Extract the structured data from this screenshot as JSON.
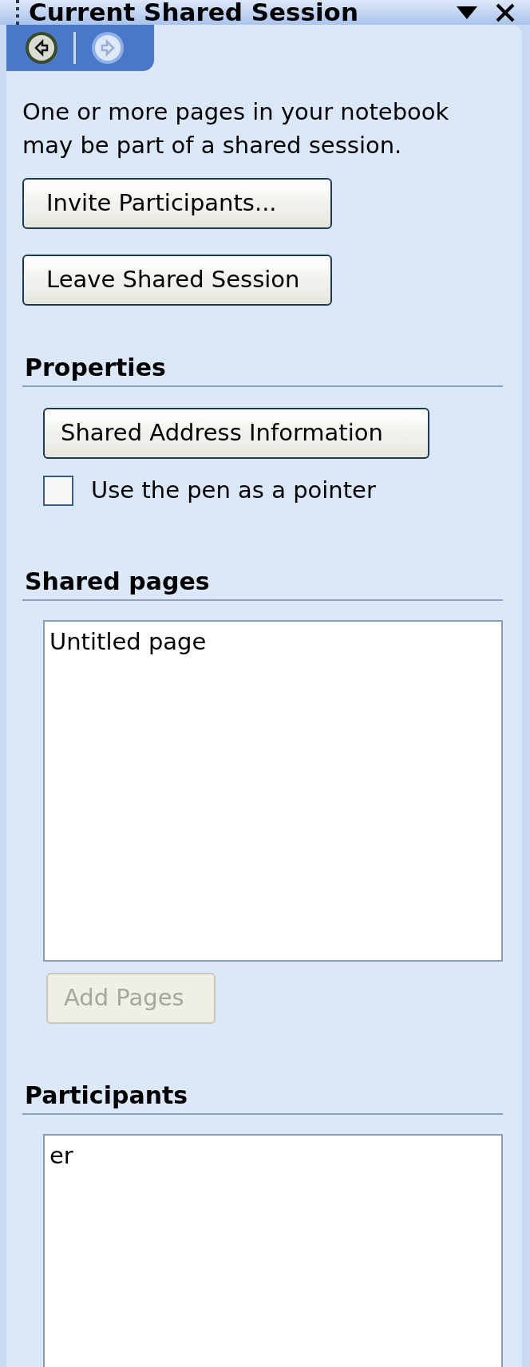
{
  "panel": {
    "title": "Current Shared Session"
  },
  "navigation": [
    {
      "kind": "back",
      "disabled": false
    },
    {
      "kind": "forward",
      "disabled": true
    }
  ],
  "intro": "One or more pages in your notebook may be part of a shared session.",
  "session_buttons": [
    {
      "label": "Invite Participants...",
      "disabled": false
    },
    {
      "label": "Leave Shared Session",
      "disabled": false
    }
  ],
  "properties": {
    "heading": "Properties",
    "button": {
      "label": "Shared Address Information",
      "disabled": false
    },
    "checkbox": {
      "label": "Use the pen as a pointer",
      "checked": false
    }
  },
  "shared_pages": {
    "heading": "Shared pages",
    "items": [
      "Untitled page"
    ],
    "button": {
      "label": "Add Pages",
      "disabled": true
    }
  },
  "participants": {
    "heading": "Participants",
    "items": [
      "er"
    ]
  }
}
